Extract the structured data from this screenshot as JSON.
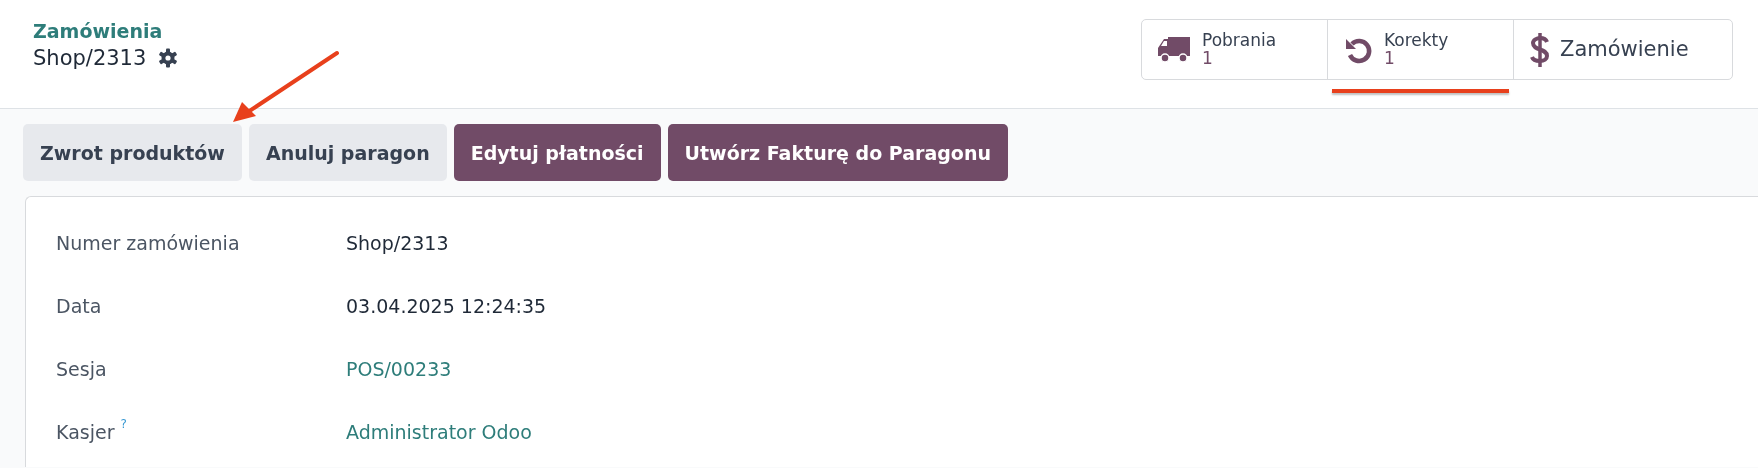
{
  "breadcrumb": {
    "parent": "Zamówienia",
    "current": "Shop/2313"
  },
  "smart_buttons": [
    {
      "label": "Pobrania",
      "count": "1",
      "highlighted": false
    },
    {
      "label": "Korekty",
      "count": "1",
      "highlighted": true
    },
    {
      "label": "Zamówienie",
      "highlighted": false
    }
  ],
  "actions": [
    {
      "label": "Zwrot produktów",
      "kind": "secondary"
    },
    {
      "label": "Anuluj paragon",
      "kind": "secondary"
    },
    {
      "label": "Edytuj płatności",
      "kind": "primary"
    },
    {
      "label": "Utwórz Fakturę do Paragonu",
      "kind": "primary"
    }
  ],
  "annotations": [
    {
      "kind": "arrow"
    }
  ],
  "fields": [
    {
      "label": "Numer zamówienia",
      "value": "Shop/2313",
      "kind": "text"
    },
    {
      "label": "Data",
      "value": "03.04.2025 12:24:35",
      "kind": "text"
    },
    {
      "label": "Sesja",
      "value": "POS/00233",
      "kind": "link"
    },
    {
      "label": "Kasjer",
      "value": "Administrator Odoo",
      "kind": "link",
      "help": "?"
    }
  ]
}
